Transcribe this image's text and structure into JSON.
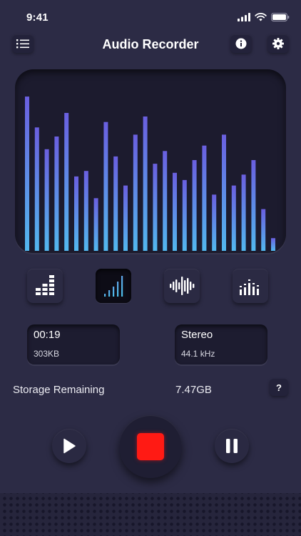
{
  "status_bar": {
    "time": "9:41",
    "icons": [
      "signal-icon",
      "wifi-icon",
      "battery-icon"
    ]
  },
  "header": {
    "title": "Audio Recorder",
    "left_icon": "list-icon",
    "right_icons": [
      "info-icon",
      "gear-icon"
    ]
  },
  "visualizer": {
    "levels": [
      0.85,
      0.68,
      0.56,
      0.63,
      0.76,
      0.41,
      0.44,
      0.29,
      0.71,
      0.52,
      0.36,
      0.64,
      0.74,
      0.48,
      0.55,
      0.43,
      0.39,
      0.5,
      0.58,
      0.31,
      0.64,
      0.36,
      0.42,
      0.5,
      0.23,
      0.07
    ],
    "color_top": "#6a5fe0",
    "color_bottom": "#52b8ee"
  },
  "modes": [
    {
      "id": "bars",
      "icon": "bar-levels-icon",
      "active": false
    },
    {
      "id": "signal",
      "icon": "signal-bars-icon",
      "active": true
    },
    {
      "id": "wave",
      "icon": "waveform-icon",
      "active": false
    },
    {
      "id": "dots",
      "icon": "dot-equalizer-icon",
      "active": false
    }
  ],
  "recording_info": {
    "duration": "00:19",
    "size": "303KB"
  },
  "format_info": {
    "channels": "Stereo",
    "sample_rate": "44.1 kHz"
  },
  "storage": {
    "label": "Storage Remaining",
    "value": "7.47GB",
    "help": "?"
  },
  "controls": {
    "play_icon": "play-icon",
    "record_icon": "stop-icon",
    "pause_icon": "pause-icon",
    "record_color": "#ff1a14"
  }
}
